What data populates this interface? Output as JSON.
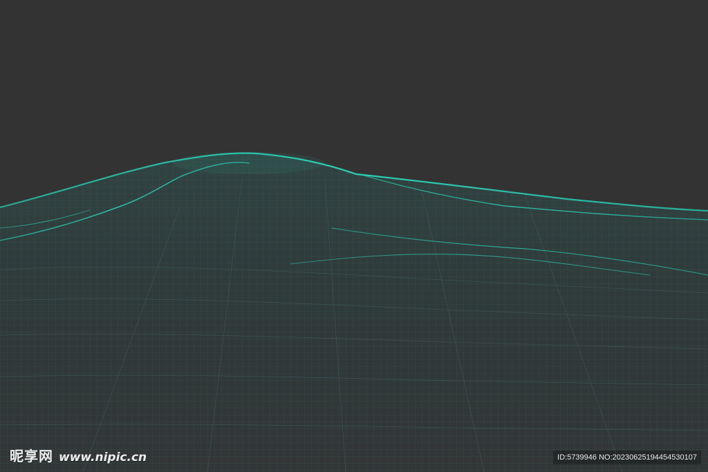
{
  "scene": {
    "background_color": "#333333",
    "mesh_color": "#2bd3b8",
    "description_tag": "wireframe-terrain"
  },
  "watermark": {
    "brand": "昵享网",
    "url": "www.nipic.cn",
    "id_line": "ID:5739946 NO:20230625194454530107"
  }
}
